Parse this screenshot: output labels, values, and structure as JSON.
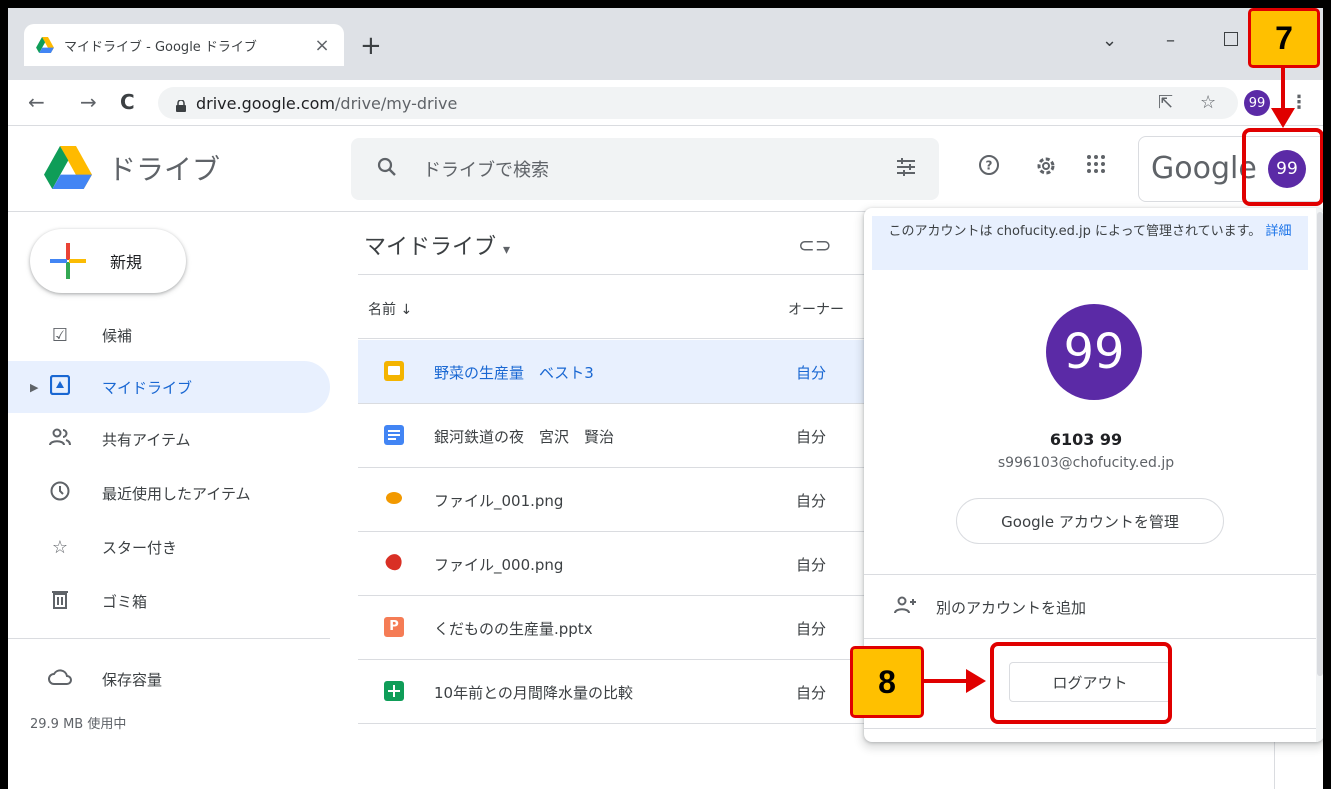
{
  "browser": {
    "tab_title": "マイドライブ - Google ドライブ",
    "tab_close": "×",
    "new_tab": "+",
    "url_host": "drive.google.com",
    "url_path": "/drive/my-drive",
    "profile": "99"
  },
  "header": {
    "logo_text": "ドライブ",
    "search_placeholder": "ドライブで検索",
    "google_word": "Google",
    "avatar": "99"
  },
  "sidebar": {
    "new_label": "新規",
    "items": [
      {
        "label": "候補",
        "icon": "suggested-icon"
      },
      {
        "label": "マイドライブ",
        "icon": "my-drive-icon"
      },
      {
        "label": "共有アイテム",
        "icon": "shared-icon"
      },
      {
        "label": "最近使用したアイテム",
        "icon": "clock-icon"
      },
      {
        "label": "スター付き",
        "icon": "star-icon"
      },
      {
        "label": "ゴミ箱",
        "icon": "trash-icon"
      }
    ],
    "storage_label": "保存容量",
    "storage_usage": "29.9 MB 使用中"
  },
  "main": {
    "title": "マイドライブ",
    "col_name": "名前",
    "col_owner": "オーナー",
    "files": [
      {
        "name": "野菜の生産量　ベスト3",
        "owner": "自分",
        "type": "slides",
        "color": "#f4b400"
      },
      {
        "name": "銀河鉄道の夜　宮沢　賢治",
        "owner": "自分",
        "type": "docs",
        "color": "#4285f4"
      },
      {
        "name": "ファイル_001.png",
        "owner": "自分",
        "type": "image",
        "color": "#f29900"
      },
      {
        "name": "ファイル_000.png",
        "owner": "自分",
        "type": "image",
        "color": "#d93025"
      },
      {
        "name": "くだものの生産量.pptx",
        "owner": "自分",
        "type": "pptx",
        "color": "#f57c55"
      },
      {
        "name": "10年前との月間降水量の比較",
        "owner": "自分",
        "type": "sheets",
        "color": "#0f9d58"
      }
    ]
  },
  "popup": {
    "notice_text": "このアカウントは chofucity.ed.jp によって管理されています。",
    "notice_link": "詳細",
    "avatar": "99",
    "name": "6103 99",
    "email": "s996103@chofucity.ed.jp",
    "manage_label": "Google アカウントを管理",
    "add_account_label": "別のアカウントを追加",
    "logout_label": "ログアウト"
  },
  "annotations": {
    "step7": "7",
    "step8": "8",
    "highlight_color": "#e00000",
    "badge_color": "#ffc000"
  }
}
